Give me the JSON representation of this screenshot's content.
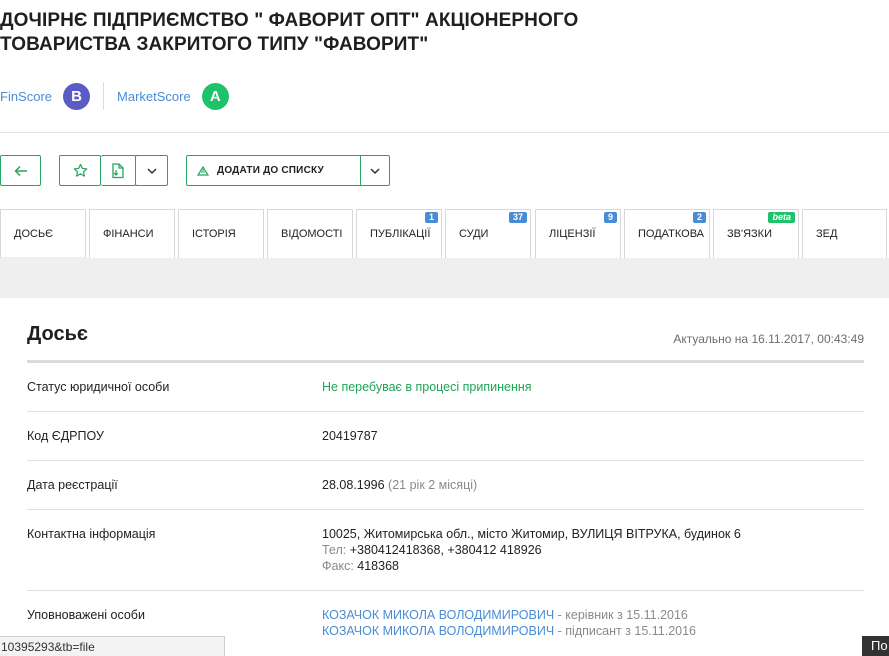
{
  "company": {
    "title_line1": "ДОЧІРНЄ ПІДПРИЄМСТВО \" ФАВОРИТ ОПТ\" АКЦІОНЕРНОГО",
    "title_line2": "ТОВАРИСТВА ЗАКРИТОГО ТИПУ \"ФАВОРИТ\""
  },
  "scores": {
    "fin_label": "FinScore",
    "fin_value": "B",
    "market_label": "MarketScore",
    "market_value": "A"
  },
  "toolbar": {
    "add_to_list_label": "ДОДАТИ ДО СПИСКУ"
  },
  "tabs": [
    {
      "label": "ДОСЬЄ",
      "badge": ""
    },
    {
      "label": "ФІНАНСИ",
      "badge": ""
    },
    {
      "label": "ІСТОРІЯ",
      "badge": ""
    },
    {
      "label": "ВІДОМОСТІ",
      "badge": ""
    },
    {
      "label": "ПУБЛІКАЦІЇ",
      "badge": "1"
    },
    {
      "label": "СУДИ",
      "badge": "37"
    },
    {
      "label": "ЛІЦЕНЗІЇ",
      "badge": "9"
    },
    {
      "label": "ПОДАТКОВА",
      "badge": "2"
    },
    {
      "label": "ЗВ'ЯЗКИ",
      "badge": "beta"
    },
    {
      "label": "ЗЕД",
      "badge": ""
    }
  ],
  "dossier": {
    "title": "Досьє",
    "actual_at": "Актуально на 16.11.2017, 00:43:49",
    "rows": {
      "status": {
        "label": "Статус юридичної особи",
        "value": "Не перебуває в процесі припинення"
      },
      "edrpou": {
        "label": "Код ЄДРПОУ",
        "value": "20419787"
      },
      "registration": {
        "label": "Дата реєстрації",
        "value": "28.08.1996",
        "age": "(21 рік 2 місяці)"
      },
      "contacts": {
        "label": "Контактна інформація",
        "address": "10025, Житомирська обл., місто Житомир, ВУЛИЦЯ ВІТРУКА, будинок 6",
        "phone_label": "Тел:",
        "phone": "+380412418368, +380412 418926",
        "fax_label": "Факс:",
        "fax": "418368"
      },
      "authorized": {
        "label": "Уповноважені особи",
        "persons": [
          {
            "name": "КОЗАЧОК МИКОЛА ВОЛОДИМИРОВИЧ",
            "role": " - керівник з 15.11.2016"
          },
          {
            "name": "КОЗАЧОК МИКОЛА ВОЛОДИМИРОВИЧ",
            "role": " - підписант з 15.11.2016"
          }
        ]
      }
    }
  },
  "statusbar": {
    "url": "10395293&tb=file",
    "corner_button": "По"
  },
  "colors": {
    "accent_green": "#25a55f",
    "link_blue": "#4a8bd6",
    "finscore_badge": "#5b5bc5",
    "marketscore_badge": "#1ec26b"
  }
}
